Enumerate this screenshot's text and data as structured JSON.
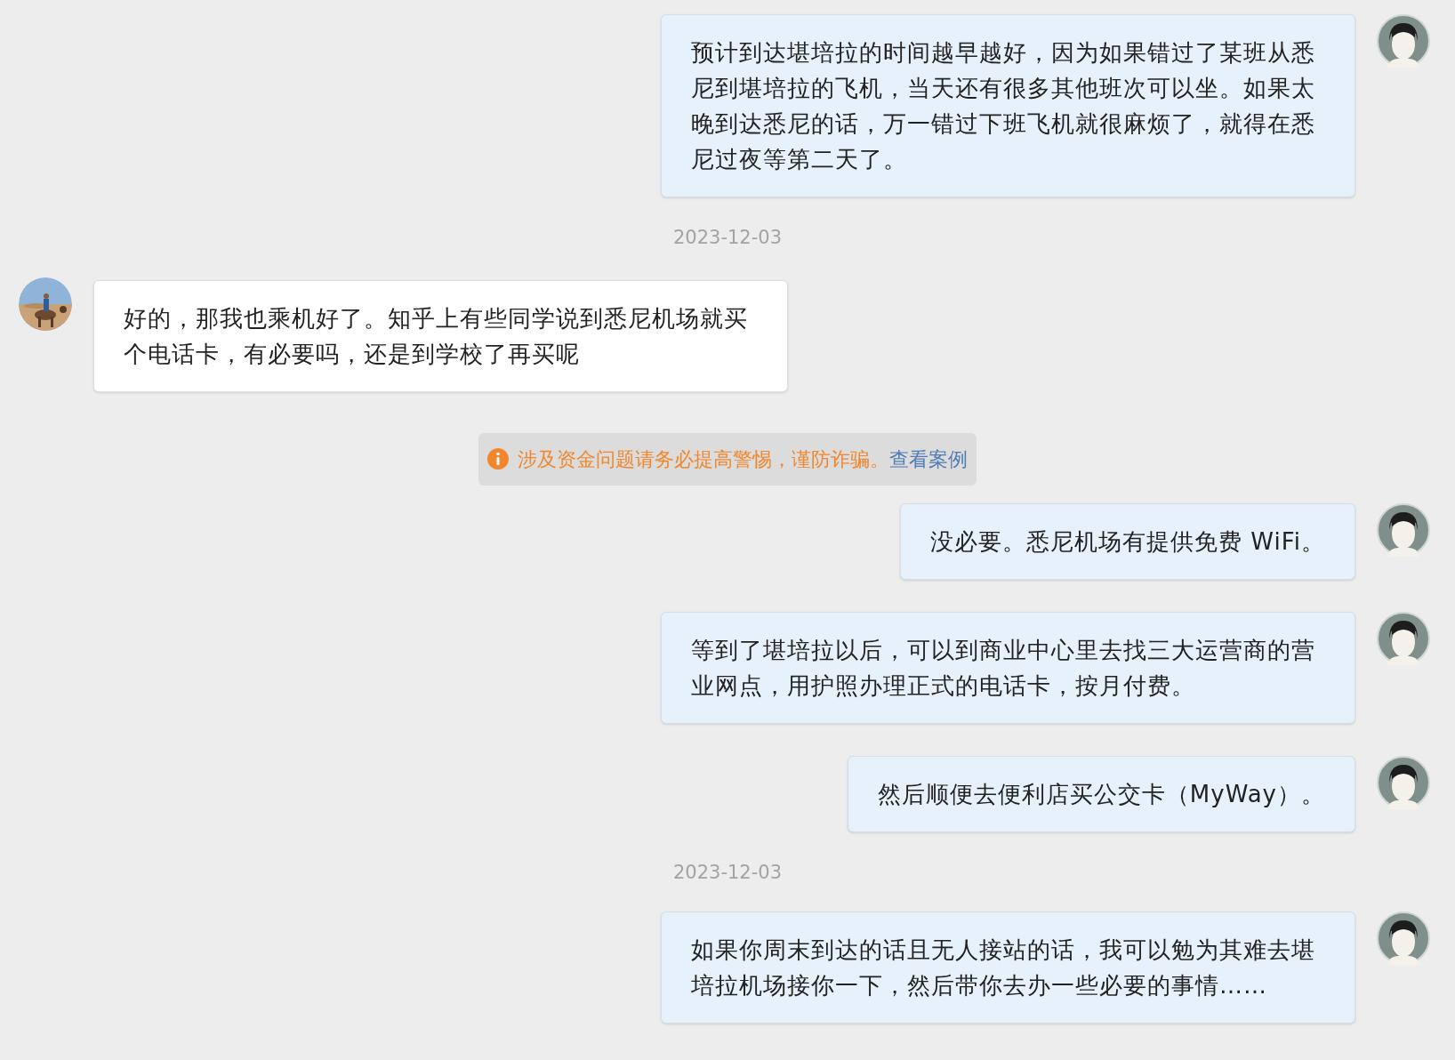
{
  "messages": [
    {
      "kind": "sent",
      "text": "预计到达堪培拉的时间越早越好，因为如果错过了某班从悉尼到堪培拉的飞机，当天还有很多其他班次可以坐。如果太晚到达悉尼的话，万一错过下班飞机就很麻烦了，就得在悉尼过夜等第二天了。"
    },
    {
      "kind": "date",
      "text": "2023-12-03"
    },
    {
      "kind": "received",
      "text": "好的，那我也乘机好了。知乎上有些同学说到悉尼机场就买个电话卡，有必要吗，还是到学校了再买呢"
    },
    {
      "kind": "notice",
      "text": "涉及资金问题请务必提高警惕，谨防诈骗。",
      "link": "查看案例"
    },
    {
      "kind": "sent",
      "text": "没必要。悉尼机场有提供免费 WiFi。"
    },
    {
      "kind": "sent",
      "text": "等到了堪培拉以后，可以到商业中心里去找三大运营商的营业网点，用护照办理正式的电话卡，按月付费。"
    },
    {
      "kind": "sent",
      "text": "然后顺便去便利店买公交卡（MyWay）。"
    },
    {
      "kind": "date",
      "text": "2023-12-03"
    },
    {
      "kind": "sent",
      "text": "如果你周末到达的话且无人接站的话，我可以勉为其难去堪培拉机场接你一下，然后带你去办一些必要的事情……"
    }
  ]
}
